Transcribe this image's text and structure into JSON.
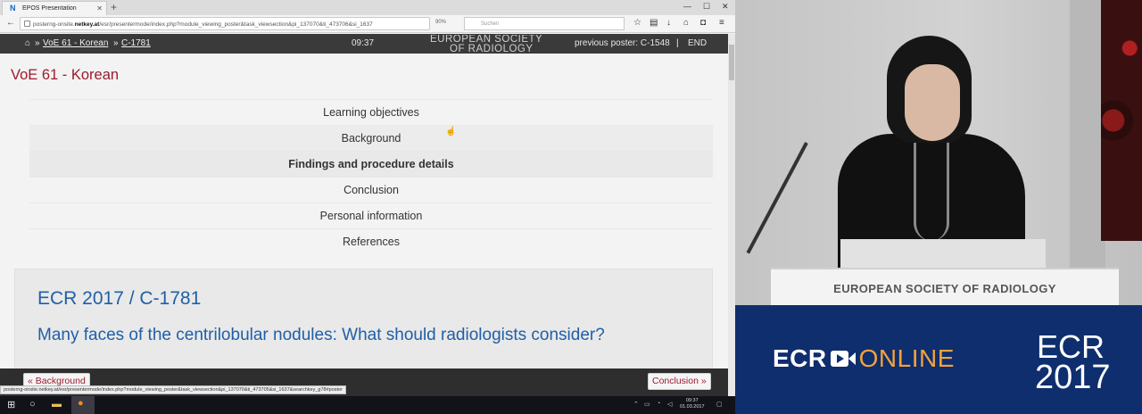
{
  "browser": {
    "tab_title": "EPOS Presentation",
    "url_prefix": "posterng-onsite.",
    "url_host": "netkey.at",
    "url_rest": "/esr/presentermode/index.php?module_viewing_poster&task_viewsection&pi_137070&ti_473706&si_1637",
    "zoom": "90%",
    "search_placeholder": "Suchen",
    "status_url": "posterng-onsite.netkey.at/esr/presentermode/index.php?module_viewing_poster&task_viewsection&pi_137070&ti_473705&si_1637&searchkey_g78#poster"
  },
  "header": {
    "crumb_sep": "»",
    "crumb_1": "VoE 61 - Korean",
    "crumb_2": "C-1781",
    "time": "09:37",
    "logo_line1": "EUROPEAN SOCIETY",
    "logo_line2": "OF RADIOLOGY",
    "previous_poster": "previous poster: C-1548",
    "divider": "|",
    "end": "END"
  },
  "page": {
    "title": "VoE 61 - Korean",
    "toc": [
      {
        "label": "Learning objectives"
      },
      {
        "label": "Background"
      },
      {
        "label": "Findings and procedure details"
      },
      {
        "label": "Conclusion"
      },
      {
        "label": "Personal information"
      },
      {
        "label": "References"
      }
    ],
    "card_code": "ECR 2017 / C-1781",
    "card_title": "Many faces of the centrilobular nodules: What should radiologists consider?",
    "prev_button": "« Background",
    "next_button": "Conclusion »"
  },
  "taskbar": {
    "time": "09:37",
    "date": "01.03.2017"
  },
  "video": {
    "lectern_text": "EUROPEAN SOCIETY OF RADIOLOGY"
  },
  "banner": {
    "ecr": "ECR",
    "online": "ONLINE",
    "year_ecr": "ECR",
    "year": "2017"
  },
  "colors": {
    "title_red": "#9b1b2e",
    "link_blue": "#1f5fa8",
    "header_dark": "#3a3a3a",
    "banner_blue": "#0e2e6e",
    "online_orange": "#f4a23c"
  }
}
